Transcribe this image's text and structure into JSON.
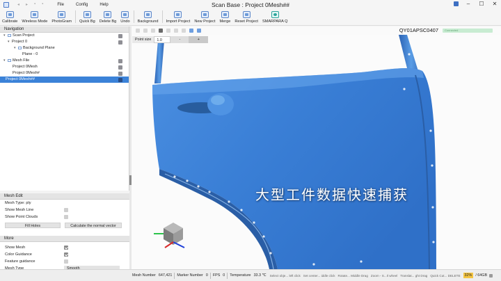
{
  "titlebar": {
    "title": "Scan Base : Project 0Mesh##",
    "menu": [
      "File",
      "Config",
      "Help"
    ]
  },
  "toolbar": {
    "items": [
      "Calibrate",
      "Wireless Mode",
      "PhotoGram",
      "Quick Bg",
      "Delete Bg",
      "Undo",
      "Background",
      "Import Project",
      "New Project",
      "Merge",
      "Reset Project",
      "SMARPARA Q"
    ]
  },
  "navigation": {
    "header": "Navigation",
    "rows": [
      "Scan Project",
      "Project 0",
      "Background Plane",
      "Plane - 0",
      "Mesh File",
      "Project 0Mesh",
      "Project 0Mesh#",
      "Project 0Mesh##"
    ]
  },
  "mesh_edit": {
    "header": "Mesh Edit",
    "mesh_type": "Mesh Type: ply",
    "show_mesh_line": "Show Mesh Line",
    "show_point_clouds": "Show Point Clouds",
    "fill_holes": "Fill Holes",
    "calc_normal": "Calculate the normal vector"
  },
  "more": {
    "header": "More",
    "show_mesh": "Show Mesh",
    "color_guidance": "Color Guidance",
    "feature_guidance": "Feature guidance",
    "mesh_type_label": "Mesh Type",
    "mesh_type_value": "Smooth"
  },
  "viewport": {
    "device_id": "QY01APSC0407",
    "status": "Connected",
    "point_size_label": "Point size",
    "point_size_value": "1.0",
    "minus": "-",
    "plus": "+",
    "caption": "大型工件数据快速捕获"
  },
  "statusbar": {
    "mesh_number_label": "Mesh Number",
    "mesh_number_value": "647,421",
    "marker_number_label": "Marker Number",
    "marker_number_value": "0",
    "fps_label": "FPS",
    "fps_value": "0",
    "temperature_label": "Temperature",
    "temperature_value": "33.3 ℃",
    "hints": [
      "Select obje... left click",
      "Set center... iddle click",
      "Rotate... Middle Drag",
      "Zoom - S...Il wheel",
      "Translat... ght Drag",
      "Quick Cut... DELETE"
    ],
    "disk_used": "32%",
    "disk_total": "/ 64GB"
  },
  "colors": {
    "mesh_blue": "#3d7fd6",
    "selection": "#3b82d8"
  }
}
